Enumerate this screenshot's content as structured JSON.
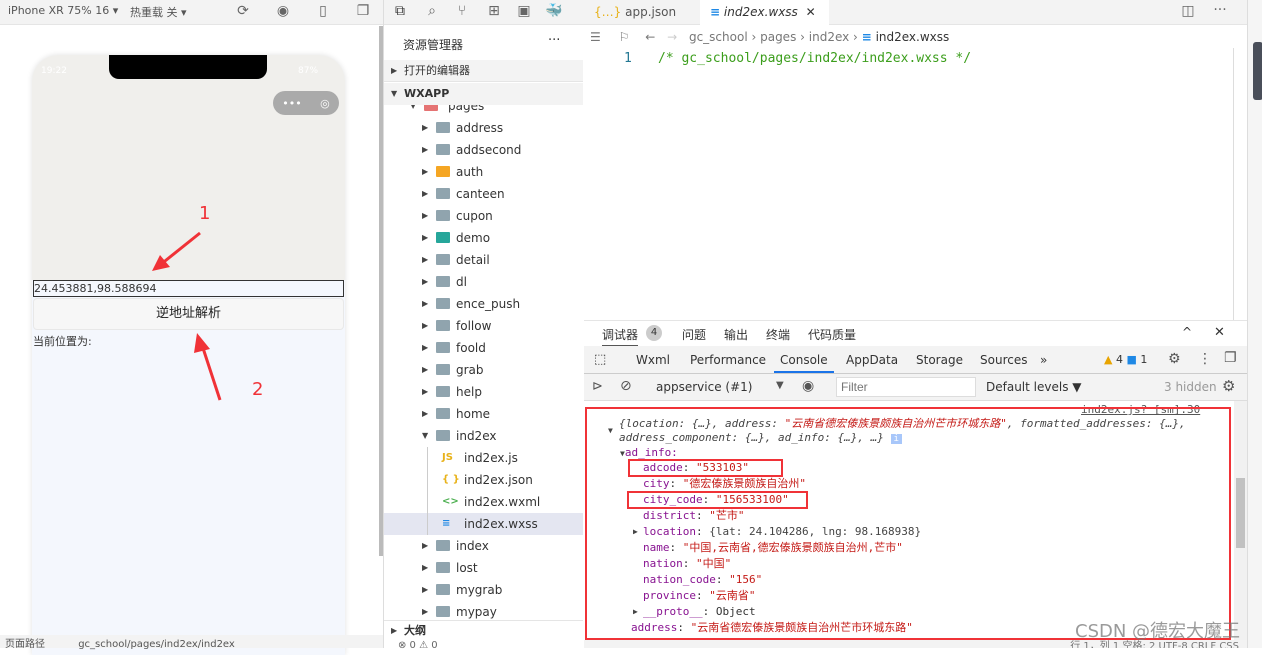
{
  "simulator": {
    "device": "iPhone XR 75% 16 ▾",
    "hot_reload": "热重载 关 ▾",
    "time": "19:22",
    "battery": "87%",
    "input_value": "24.453881,98.588694",
    "button_label": "逆地址解析",
    "location_label": "当前位置为:",
    "annotation_1": "1",
    "annotation_2": "2",
    "page_path_label": "页面路径",
    "page_path": "gc_school/pages/ind2ex/ind2ex"
  },
  "explorer": {
    "title": "资源管理器",
    "more": "···",
    "open_editors": "打开的编辑器",
    "project": "WXAPP",
    "outline": "大纲",
    "status": "⊗ 0 ⚠ 0",
    "items": [
      {
        "label": "pages",
        "type": "folder-open"
      },
      {
        "label": "address"
      },
      {
        "label": "addsecond"
      },
      {
        "label": "auth"
      },
      {
        "label": "canteen"
      },
      {
        "label": "cupon"
      },
      {
        "label": "demo"
      },
      {
        "label": "detail"
      },
      {
        "label": "dl"
      },
      {
        "label": "ence_push"
      },
      {
        "label": "follow"
      },
      {
        "label": "foold"
      },
      {
        "label": "grab"
      },
      {
        "label": "help"
      },
      {
        "label": "home"
      },
      {
        "label": "ind2ex"
      },
      {
        "label": "index"
      },
      {
        "label": "lost"
      },
      {
        "label": "mygrab"
      },
      {
        "label": "mypay"
      }
    ],
    "ind2ex_children": [
      {
        "label": "ind2ex.js",
        "icon": "JS",
        "color": "#e8b21a"
      },
      {
        "label": "ind2ex.json",
        "icon": "{ }",
        "color": "#e8b21a"
      },
      {
        "label": "ind2ex.wxml",
        "icon": "<>",
        "color": "#4caf50"
      },
      {
        "label": "ind2ex.wxss",
        "icon": "≡",
        "color": "#1e88e5"
      }
    ]
  },
  "editor": {
    "tabs": [
      {
        "label": "app.json",
        "icon": "{…}"
      },
      {
        "label": "ind2ex.wxss",
        "icon": "≡",
        "active": true
      }
    ],
    "breadcrumb": [
      "gc_school",
      "pages",
      "ind2ex",
      "ind2ex.wxss"
    ],
    "line_number": "1",
    "code": "/* gc_school/pages/ind2ex/ind2ex.wxss */"
  },
  "devtools": {
    "panel_tabs": [
      "调试器",
      "问题",
      "输出",
      "终端",
      "代码质量"
    ],
    "badge": "4",
    "tabs": [
      "Wxml",
      "Performance",
      "Console",
      "AppData",
      "Storage",
      "Sources",
      "»"
    ],
    "active_tab": "Console",
    "warnings": "4",
    "messages": "1",
    "context": "appservice (#1)",
    "filter_placeholder": "Filter",
    "levels": "Default levels ▼",
    "hidden": "3 hidden",
    "source_link": "ind2ex.js? [sm]:30",
    "console": {
      "summary1": "{location: {…}, address: ",
      "summary_addr": "\"云南省德宏傣族景颇族自治州芒市环城东路\"",
      "summary1b": ", formatted_addresses: {…},",
      "summary2": "address_component: {…}, ad_info: {…}, …}",
      "ad_info": "ad_info:",
      "rows": [
        {
          "key": "adcode",
          "value": "\"533103\""
        },
        {
          "key": "city",
          "value": "\"德宏傣族景颇族自治州\""
        },
        {
          "key": "city_code",
          "value": "\"156533100\""
        },
        {
          "key": "district",
          "value": "\"芒市\""
        },
        {
          "key": "location",
          "value": "{lat: 24.104286, lng: 98.168938}"
        },
        {
          "key": "name",
          "value": "\"中国,云南省,德宏傣族景颇族自治州,芒市\""
        },
        {
          "key": "nation",
          "value": "\"中国\""
        },
        {
          "key": "nation_code",
          "value": "\"156\""
        },
        {
          "key": "province",
          "value": "\"云南省\""
        },
        {
          "key": "__proto__",
          "value": "Object"
        }
      ],
      "address_key": "address",
      "address_value": "\"云南省德宏傣族景颇族自治州芒市环城东路\""
    }
  },
  "statusbar": {
    "text": "行 1，列 1   空格: 2   UTF-8   CRLF   CSS"
  },
  "watermark": "CSDN @德宏大魔王",
  "colors": {
    "highlight": "#f03237",
    "selected_row": "#e4e6f1",
    "accent": "#1e88e5"
  }
}
